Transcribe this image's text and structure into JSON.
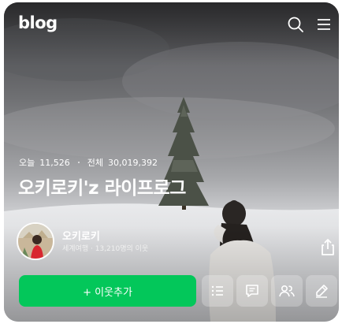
{
  "header": {
    "logo": "blog",
    "search_icon": "search-icon",
    "menu_icon": "hamburger-menu-icon"
  },
  "stats": {
    "today_label": "오늘",
    "today_value": "11,526",
    "total_label": "전체",
    "total_value": "30,019,392"
  },
  "blog_title": "오키로키'z 라이프로그",
  "profile": {
    "name": "오키로키",
    "subtitle": "세계여행 · 13,210명의 이웃",
    "share_icon": "share-icon"
  },
  "actions": {
    "add_neighbor_label": "+ 이웃추가",
    "buttons": [
      "list-icon",
      "comment-icon",
      "neighbors-icon",
      "write-icon"
    ]
  },
  "colors": {
    "accent_green": "#03c75a"
  }
}
